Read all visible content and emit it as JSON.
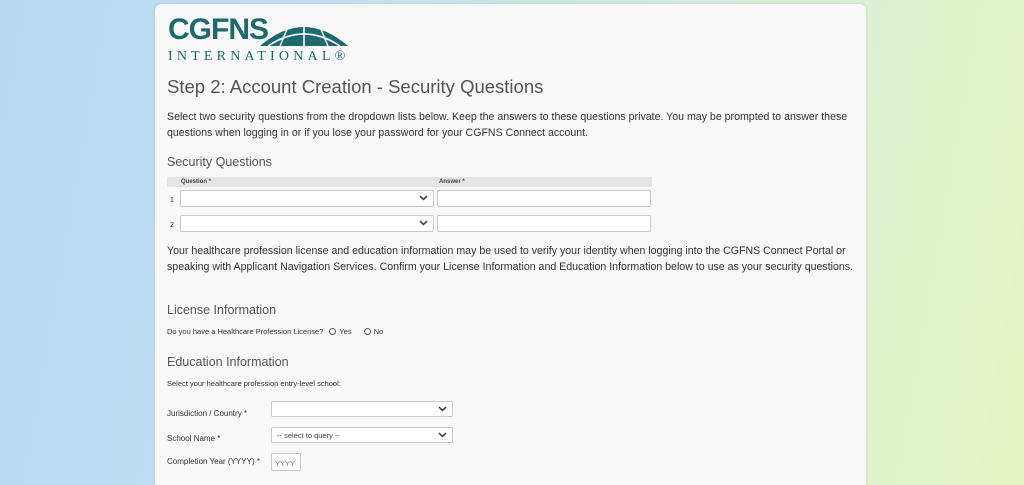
{
  "logo": {
    "brand": "CGFNS",
    "subtitle": "INTERNATIONAL®"
  },
  "page": {
    "title": "Step 2: Account Creation - Security Questions",
    "intro": "Select two security questions from the dropdown lists below. Keep the answers to these questions private. You may be prompted to answer these questions when logging in or if you lose your password for your CGFNS Connect account."
  },
  "security": {
    "heading": "Security Questions",
    "col_question": "Question *",
    "col_answer": "Answer *",
    "rows": [
      {
        "num": "1",
        "question": "",
        "answer": ""
      },
      {
        "num": "2",
        "question": "",
        "answer": ""
      }
    ]
  },
  "verify_text": "Your healthcare profession license and education information may be used to verify your identity when logging into the CGFNS Connect Portal or speaking with Applicant Navigation Services. Confirm your License Information and Education Information below to use as your security questions.",
  "license": {
    "heading": "License Information",
    "question": "Do you have a Healthcare Profession License?",
    "yes": "Yes",
    "no": "No"
  },
  "education": {
    "heading": "Education Information",
    "subtext": "Select your healthcare profession entry-level school:",
    "jurisdiction_label": "Jurisdiction / Country *",
    "jurisdiction_value": "",
    "school_label": "School Name *",
    "school_value": "-- select to query --",
    "year_label": "Completion Year (YYYY) *",
    "year_placeholder": "YYYY"
  },
  "colors": {
    "brand": "#1d6a6d"
  }
}
